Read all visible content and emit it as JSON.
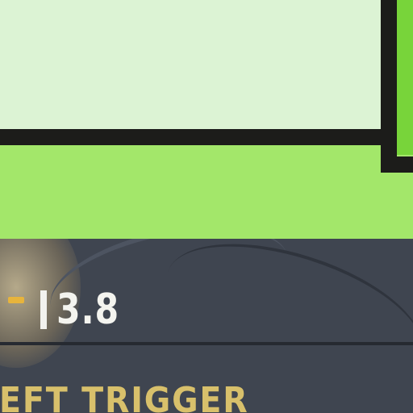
{
  "hud": {
    "value": "3.8",
    "trigger_label": "LEFT TRIGGER"
  },
  "colors": {
    "panel_pale": "#dcf3d4",
    "band_green": "#a3e76a",
    "accent_green": "#78d43a",
    "frame_dark": "#1c1c1a",
    "viewport_bg": "#3f4550",
    "hud_text": "#f4f4ef",
    "hud_accent": "#e7b43c",
    "label_text": "#d8c06b"
  }
}
